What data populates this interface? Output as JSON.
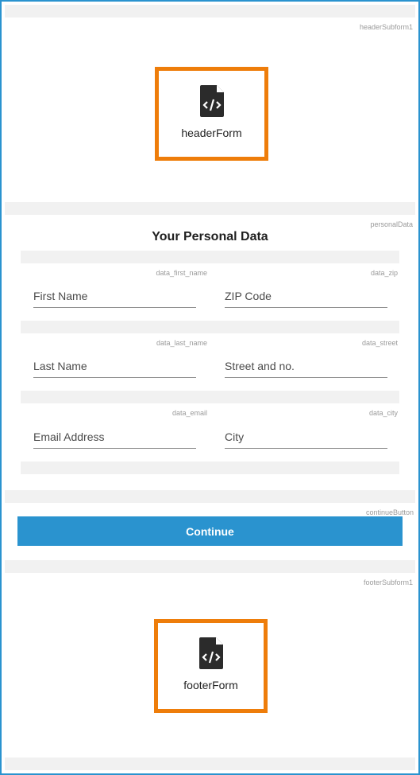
{
  "header": {
    "subform_tag": "headerSubform1",
    "form_label": "headerForm"
  },
  "personal": {
    "tag": "personalData",
    "title": "Your Personal Data",
    "rows": [
      {
        "left": {
          "tag": "data_first_name",
          "placeholder": "First Name"
        },
        "right": {
          "tag": "data_zip",
          "placeholder": "ZIP Code"
        }
      },
      {
        "left": {
          "tag": "data_last_name",
          "placeholder": "Last Name"
        },
        "right": {
          "tag": "data_street",
          "placeholder": "Street and no."
        }
      },
      {
        "left": {
          "tag": "data_email",
          "placeholder": "Email Address"
        },
        "right": {
          "tag": "data_city",
          "placeholder": "City"
        }
      }
    ]
  },
  "continue": {
    "tag": "continueButton",
    "label": "Continue"
  },
  "footer": {
    "subform_tag": "footerSubform1",
    "form_label": "footerForm"
  },
  "colors": {
    "frame": "#2a93cf",
    "accent_border": "#ee7d0a",
    "button": "#2a93cf"
  },
  "icons": {
    "embed": "code-file-icon"
  }
}
